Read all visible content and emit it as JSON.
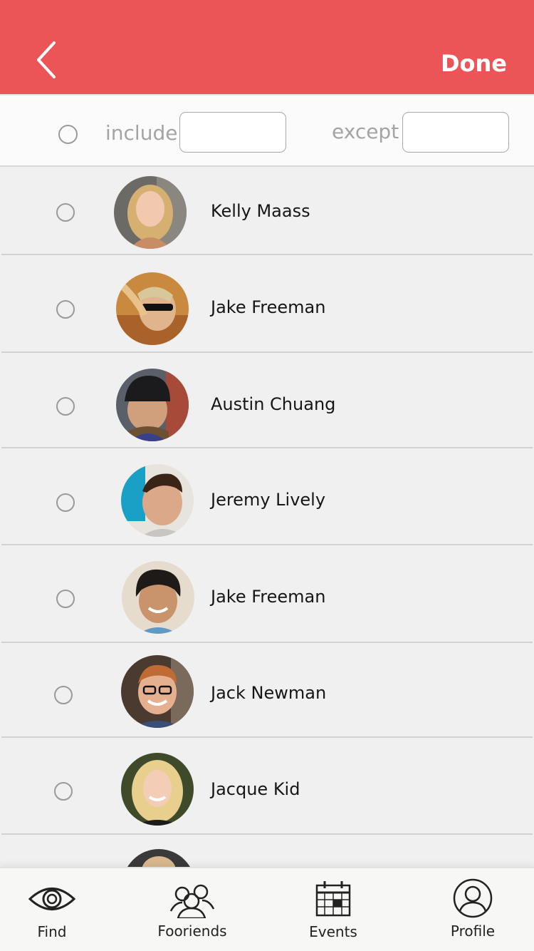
{
  "header": {
    "back_icon": "chevron-left-icon",
    "done_label": "Done",
    "background_color": "#ec5557"
  },
  "filter": {
    "include_label": "include",
    "include_value": "",
    "except_label": "except",
    "except_value": ""
  },
  "contacts": [
    {
      "name": "Kelly Maass",
      "selected": false,
      "avatar": "avatar-photo"
    },
    {
      "name": "Jake Freeman",
      "selected": false,
      "avatar": "avatar-photo"
    },
    {
      "name": "Austin Chuang",
      "selected": false,
      "avatar": "avatar-photo"
    },
    {
      "name": "Jeremy Lively",
      "selected": false,
      "avatar": "avatar-photo"
    },
    {
      "name": "Jake Freeman",
      "selected": false,
      "avatar": "avatar-photo"
    },
    {
      "name": "Jack Newman",
      "selected": false,
      "avatar": "avatar-photo"
    },
    {
      "name": "Jacque Kid",
      "selected": false,
      "avatar": "avatar-photo"
    }
  ],
  "tabs": [
    {
      "label": "Find",
      "icon": "eye-icon"
    },
    {
      "label": "Fooriends",
      "icon": "group-icon"
    },
    {
      "label": "Events",
      "icon": "calendar-icon"
    },
    {
      "label": "Profile",
      "icon": "profile-icon"
    }
  ]
}
